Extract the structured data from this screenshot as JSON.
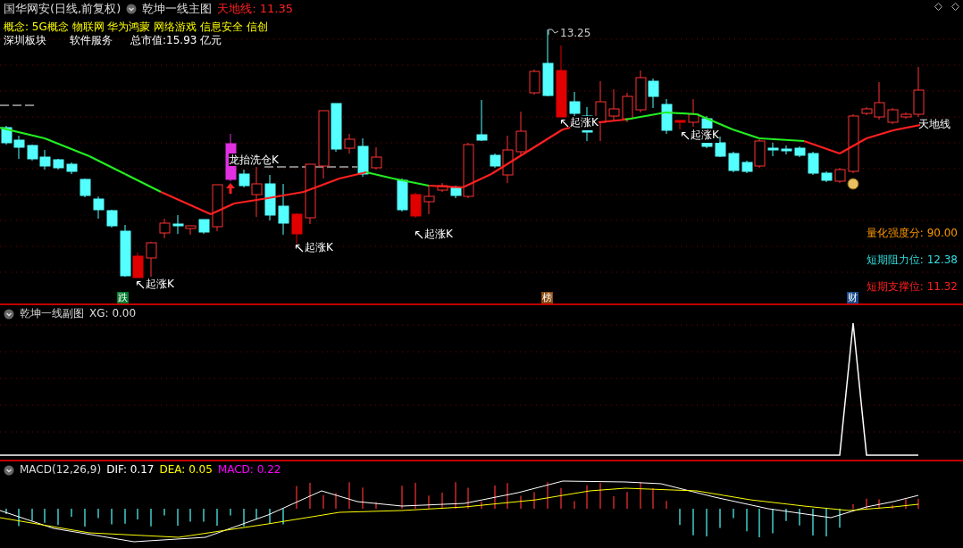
{
  "header": {
    "stock": "国华网安(日线,前复权)",
    "indicator": "乾坤一线主图",
    "line_label": "天地线:",
    "line_value": "11.35"
  },
  "info": {
    "concepts": "概念: 5G概念 物联网 华为鸿蒙 网络游戏 信息安全 信创",
    "sector": "深圳板块",
    "industry": "软件服务",
    "market_cap": "总市值:15.93 亿元"
  },
  "main_chart": {
    "high_label": "13.25",
    "line_name": "天地线",
    "special_label": "龙抬洗仓K",
    "signals": [
      {
        "text": "起涨K"
      },
      {
        "text": "起涨K"
      },
      {
        "text": "起涨K"
      },
      {
        "text": "起涨K"
      },
      {
        "text": "起涨K"
      }
    ],
    "markers": [
      {
        "text": "跌",
        "color": "#007a2e"
      },
      {
        "text": "榜",
        "color": "#8a4a10"
      },
      {
        "text": "财",
        "color": "#1a4a8a"
      }
    ],
    "stats": [
      {
        "label": "量化强度分:",
        "value": "90.00",
        "color": "#ff9900"
      },
      {
        "label": "短期阻力位:",
        "value": "12.38",
        "color": "#33dddd"
      },
      {
        "label": "短期支撑位:",
        "value": "11.32",
        "color": "#ff2020"
      }
    ]
  },
  "sub_chart": {
    "title": "乾坤一线副图",
    "reading": "XG: 0.00"
  },
  "macd": {
    "title": "MACD(12,26,9)",
    "readings": [
      {
        "text": "DIF: 0.17",
        "color": "#ffffff"
      },
      {
        "text": "DEA: 0.05",
        "color": "#ffff00"
      },
      {
        "text": "MACD: 0.22",
        "color": "#ff00ff"
      }
    ]
  }
}
